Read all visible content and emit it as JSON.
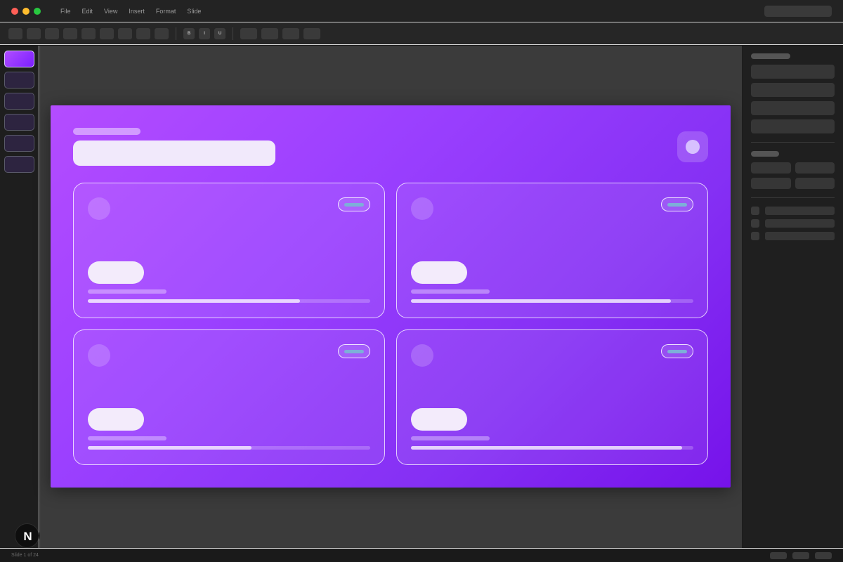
{
  "menu": [
    "File",
    "Edit",
    "View",
    "Insert",
    "Format",
    "Slide"
  ],
  "toolbar": {
    "bold": "B",
    "italic": "I",
    "underline": "U"
  },
  "status": {
    "text": "Slide 1 of 24"
  },
  "badge": {
    "letter": "N"
  },
  "colors": {
    "slide_start": "#b44cff",
    "slide_end": "#7612ea",
    "chip_accent": "#7dafd8"
  },
  "slides": {
    "count": 6,
    "active_index": 0
  },
  "cards": [
    {
      "progress": 0.75
    },
    {
      "progress": 0.92
    },
    {
      "progress": 0.58
    },
    {
      "progress": 0.96
    }
  ]
}
